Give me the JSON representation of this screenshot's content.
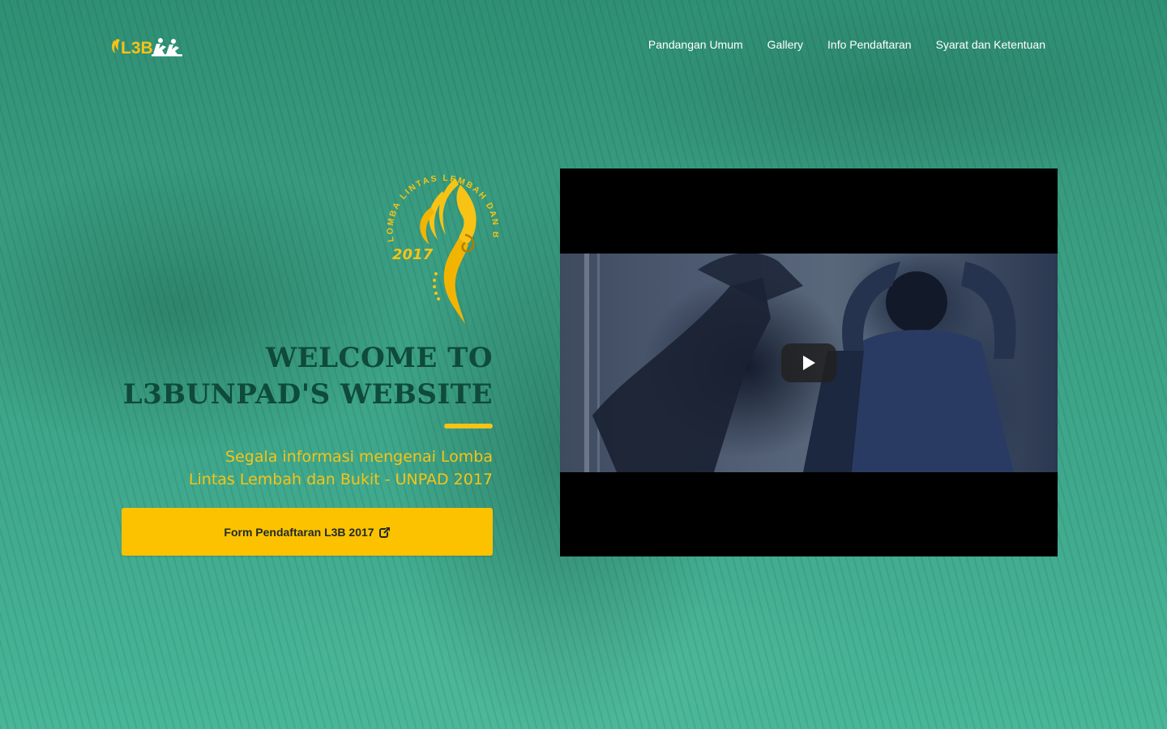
{
  "nav": {
    "brand_text": "L3B",
    "links": [
      {
        "label": "Pandangan Umum"
      },
      {
        "label": "Gallery"
      },
      {
        "label": "Info Pendaftaran"
      },
      {
        "label": "Syarat dan Ketentuan"
      }
    ]
  },
  "emblem": {
    "arc_text": "LOMBA LINTAS LEMBAH DAN BUKIT",
    "year": "2017"
  },
  "hero": {
    "title_line1": "WELCOME TO",
    "title_line2": "L3BUNPAD'S WEBSITE",
    "subtitle_line1": "Segala informasi mengenai Lomba",
    "subtitle_line2": "Lintas Lembah dan Bukit - UNPAD 2017",
    "cta_label": "Form Pendaftaran L3B 2017",
    "cta_icon": "external-link-icon"
  },
  "video": {
    "play_icon": "play-icon"
  },
  "colors": {
    "accent": "#fcc200",
    "title": "#0f4a3a",
    "background": "#3fa88c"
  }
}
